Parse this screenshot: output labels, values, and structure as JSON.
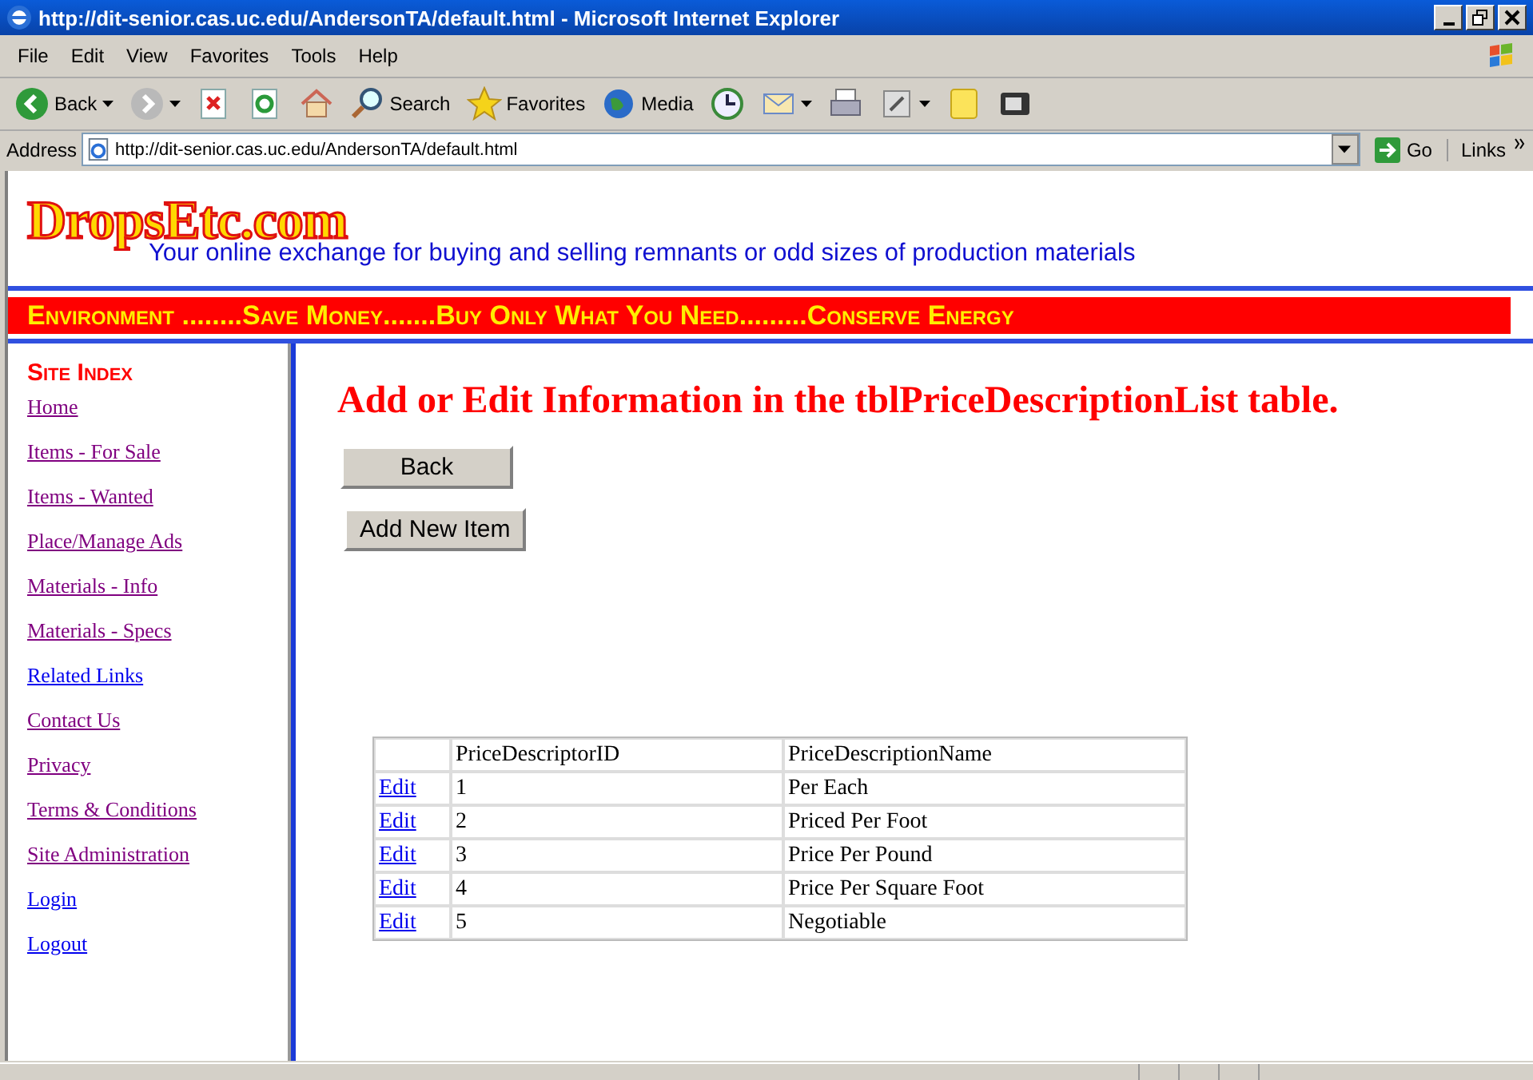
{
  "window": {
    "title": "http://dit-senior.cas.uc.edu/AndersonTA/default.html - Microsoft Internet Explorer"
  },
  "menu": [
    "File",
    "Edit",
    "View",
    "Favorites",
    "Tools",
    "Help"
  ],
  "toolbar": [
    {
      "kind": "back",
      "label": "Back",
      "dropdown": true
    },
    {
      "kind": "forward",
      "dropdown": true
    },
    {
      "kind": "stop"
    },
    {
      "kind": "refresh"
    },
    {
      "kind": "home"
    },
    {
      "kind": "search",
      "label": "Search"
    },
    {
      "kind": "favorites",
      "label": "Favorites"
    },
    {
      "kind": "media",
      "label": "Media"
    },
    {
      "kind": "history"
    },
    {
      "kind": "mail",
      "dropdown": true
    },
    {
      "kind": "print"
    },
    {
      "kind": "edit",
      "dropdown": true
    },
    {
      "kind": "note"
    },
    {
      "kind": "messenger"
    }
  ],
  "address": {
    "label": "Address",
    "url": "http://dit-senior.cas.uc.edu/AndersonTA/default.html",
    "go": "Go",
    "links": "Links"
  },
  "site": {
    "logo": "DropsEtc.com",
    "tagline": "Your online exchange for buying and selling remnants or odd sizes of production materials",
    "banner": "Environment ........Save Money.......Buy Only What You Need.........Conserve Energy"
  },
  "sidebar": {
    "title": "Site Index",
    "items": [
      {
        "label": "Home",
        "visited": true
      },
      {
        "label": "Items - For Sale",
        "visited": true
      },
      {
        "label": "Items - Wanted",
        "visited": true
      },
      {
        "label": "Place/Manage Ads",
        "visited": true
      },
      {
        "label": "Materials - Info",
        "visited": true
      },
      {
        "label": "Materials - Specs",
        "visited": true
      },
      {
        "label": "Related Links",
        "visited": false
      },
      {
        "label": "Contact Us",
        "visited": true
      },
      {
        "label": "Privacy",
        "visited": true
      },
      {
        "label": "Terms & Conditions",
        "visited": true
      },
      {
        "label": "Site Administration",
        "visited": true
      },
      {
        "label": "Login",
        "visited": false
      },
      {
        "label": "Logout",
        "visited": false
      }
    ]
  },
  "main": {
    "heading": "Add or Edit Information in the tblPriceDescriptionList table.",
    "buttons": [
      "Back",
      "Add New Item"
    ]
  },
  "table": {
    "columns": [
      "PriceDescriptorID",
      "PriceDescriptionName"
    ],
    "rows": [
      {
        "action": "Edit",
        "id": "1",
        "name": "Per Each"
      },
      {
        "action": "Edit",
        "id": "2",
        "name": "Priced Per Foot"
      },
      {
        "action": "Edit",
        "id": "3",
        "name": "Price Per Pound"
      },
      {
        "action": "Edit",
        "id": "4",
        "name": "Price Per Square Foot"
      },
      {
        "action": "Edit",
        "id": "5",
        "name": "Negotiable"
      }
    ]
  }
}
